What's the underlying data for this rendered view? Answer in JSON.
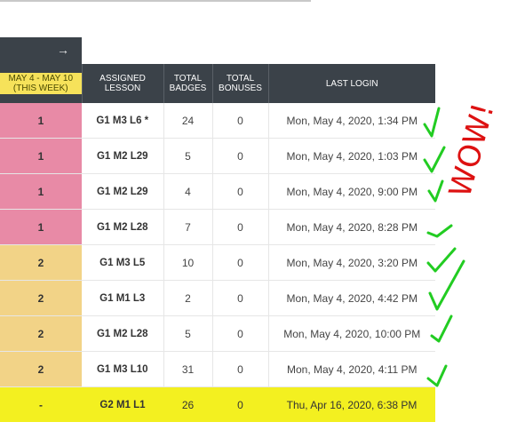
{
  "nav": {
    "arrow_icon": "→"
  },
  "columns": {
    "week": "MAY 4 - MAY 10 (THIS WEEK)",
    "lesson": "ASSIGNED LESSON",
    "badges": "TOTAL BADGES",
    "bonuses": "TOTAL BONUSES",
    "login": "LAST LOGIN"
  },
  "rows": [
    {
      "week": "1",
      "lesson": "G1 M3 L6 *",
      "badges": "24",
      "bonuses": "0",
      "login": "Mon, May 4, 2020, 1:34 PM",
      "color": "#e88aa6"
    },
    {
      "week": "1",
      "lesson": "G1 M2 L29",
      "badges": "5",
      "bonuses": "0",
      "login": "Mon, May 4, 2020, 1:03 PM",
      "color": "#e88aa6"
    },
    {
      "week": "1",
      "lesson": "G1 M2 L29",
      "badges": "4",
      "bonuses": "0",
      "login": "Mon, May 4, 2020, 9:00 PM",
      "color": "#e88aa6"
    },
    {
      "week": "1",
      "lesson": "G1 M2 L28",
      "badges": "7",
      "bonuses": "0",
      "login": "Mon, May 4, 2020, 8:28 PM",
      "color": "#e88aa6"
    },
    {
      "week": "2",
      "lesson": "G1 M3 L5",
      "badges": "10",
      "bonuses": "0",
      "login": "Mon, May 4, 2020, 3:20 PM",
      "color": "#f2d387"
    },
    {
      "week": "2",
      "lesson": "G1 M1 L3",
      "badges": "2",
      "bonuses": "0",
      "login": "Mon, May 4, 2020, 4:42 PM",
      "color": "#f2d387"
    },
    {
      "week": "2",
      "lesson": "G1 M2 L28",
      "badges": "5",
      "bonuses": "0",
      "login": "Mon, May 4, 2020, 10:00 PM",
      "color": "#f2d387"
    },
    {
      "week": "2",
      "lesson": "G1 M3 L10",
      "badges": "31",
      "bonuses": "0",
      "login": "Mon, May 4, 2020, 4:11 PM",
      "color": "#f2d387"
    },
    {
      "week": "-",
      "lesson": "G2 M1 L1",
      "badges": "26",
      "bonuses": "0",
      "login": "Thu, Apr 16, 2020, 6:38 PM",
      "color": "#f3f020"
    }
  ],
  "annotation": {
    "text": "WOW!",
    "check_color": "#22cc22",
    "wow_color": "#dd1111",
    "highlight_color": "#f3f020"
  }
}
